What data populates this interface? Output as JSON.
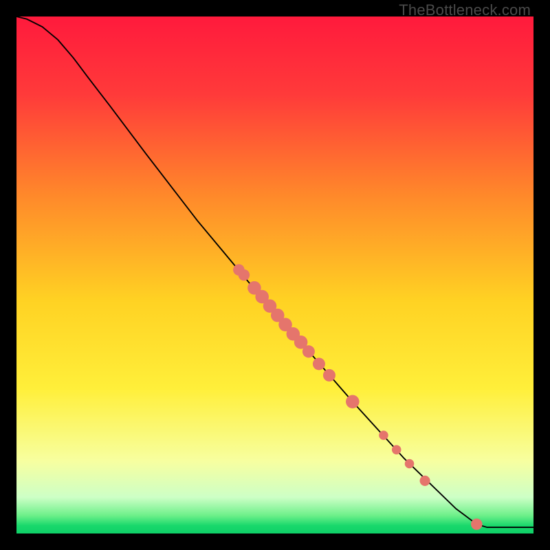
{
  "watermark": "TheBottleneck.com",
  "chart_data": {
    "type": "line",
    "title": "",
    "xlabel": "",
    "ylabel": "",
    "xlim": [
      0,
      100
    ],
    "ylim": [
      0,
      100
    ],
    "gradient_stops": [
      {
        "offset": 0.0,
        "color": "#ff1a3c"
      },
      {
        "offset": 0.15,
        "color": "#ff3a3a"
      },
      {
        "offset": 0.35,
        "color": "#ff8a2a"
      },
      {
        "offset": 0.55,
        "color": "#ffd223"
      },
      {
        "offset": 0.72,
        "color": "#ffef3a"
      },
      {
        "offset": 0.86,
        "color": "#f7ffa0"
      },
      {
        "offset": 0.93,
        "color": "#cdffc6"
      },
      {
        "offset": 0.965,
        "color": "#6ef08a"
      },
      {
        "offset": 0.985,
        "color": "#19d86b"
      },
      {
        "offset": 1.0,
        "color": "#0fd068"
      }
    ],
    "curve": [
      {
        "x": 0.0,
        "y": 100.0
      },
      {
        "x": 2.0,
        "y": 99.5
      },
      {
        "x": 5.0,
        "y": 98.0
      },
      {
        "x": 8.0,
        "y": 95.5
      },
      {
        "x": 11.0,
        "y": 92.0
      },
      {
        "x": 14.0,
        "y": 88.0
      },
      {
        "x": 18.0,
        "y": 82.8
      },
      {
        "x": 25.0,
        "y": 73.5
      },
      {
        "x": 35.0,
        "y": 60.5
      },
      {
        "x": 45.0,
        "y": 48.5
      },
      {
        "x": 55.0,
        "y": 37.0
      },
      {
        "x": 65.0,
        "y": 25.5
      },
      {
        "x": 75.0,
        "y": 14.5
      },
      {
        "x": 85.0,
        "y": 4.8
      },
      {
        "x": 89.0,
        "y": 1.8
      },
      {
        "x": 91.0,
        "y": 1.2
      },
      {
        "x": 100.0,
        "y": 1.2
      }
    ],
    "points": [
      {
        "x": 43.0,
        "y": 51.0,
        "r": 1.1
      },
      {
        "x": 44.0,
        "y": 50.0,
        "r": 1.1
      },
      {
        "x": 46.0,
        "y": 47.5,
        "r": 1.3
      },
      {
        "x": 47.5,
        "y": 45.8,
        "r": 1.3
      },
      {
        "x": 49.0,
        "y": 44.0,
        "r": 1.3
      },
      {
        "x": 50.5,
        "y": 42.2,
        "r": 1.3
      },
      {
        "x": 52.0,
        "y": 40.4,
        "r": 1.3
      },
      {
        "x": 53.5,
        "y": 38.6,
        "r": 1.3
      },
      {
        "x": 55.0,
        "y": 37.0,
        "r": 1.3
      },
      {
        "x": 56.5,
        "y": 35.2,
        "r": 1.2
      },
      {
        "x": 58.5,
        "y": 32.8,
        "r": 1.2
      },
      {
        "x": 60.5,
        "y": 30.6,
        "r": 1.2
      },
      {
        "x": 65.0,
        "y": 25.5,
        "r": 1.3
      },
      {
        "x": 71.0,
        "y": 19.0,
        "r": 0.9
      },
      {
        "x": 73.5,
        "y": 16.2,
        "r": 0.9
      },
      {
        "x": 76.0,
        "y": 13.5,
        "r": 0.9
      },
      {
        "x": 79.0,
        "y": 10.2,
        "r": 1.0
      },
      {
        "x": 89.0,
        "y": 1.8,
        "r": 1.1
      }
    ],
    "point_color": "#e5756c",
    "curve_color": "#000000"
  }
}
